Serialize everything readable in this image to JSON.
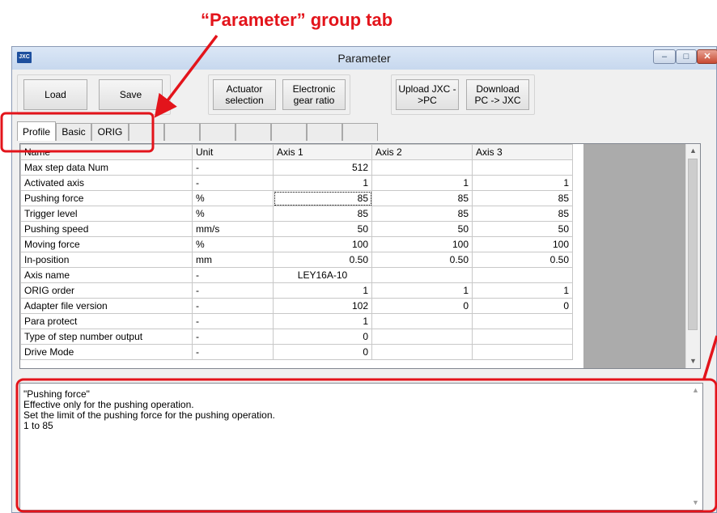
{
  "annotation": {
    "tab_callout": "“Parameter” group tab"
  },
  "window": {
    "app_icon": "JXC",
    "title": "Parameter",
    "minimize_glyph": "–",
    "maximize_glyph": "□",
    "close_glyph": "✕"
  },
  "toolbar": {
    "load": "Load",
    "save": "Save",
    "actuator": "Actuator selection",
    "gear": "Electronic gear ratio",
    "upload": "Upload JXC ->PC",
    "download": "Download PC -> JXC"
  },
  "tabs": [
    "Profile",
    "Basic",
    "ORIG"
  ],
  "grid": {
    "headers": [
      "Name",
      "Unit",
      "Axis 1",
      "Axis 2",
      "Axis 3"
    ],
    "rows": [
      [
        "Max step data Num",
        "-",
        "512",
        "",
        ""
      ],
      [
        "Activated axis",
        "-",
        "1",
        "1",
        "1"
      ],
      [
        "Pushing force",
        "%",
        "85",
        "85",
        "85"
      ],
      [
        "Trigger level",
        "%",
        "85",
        "85",
        "85"
      ],
      [
        "Pushing speed",
        "mm/s",
        "50",
        "50",
        "50"
      ],
      [
        "Moving force",
        "%",
        "100",
        "100",
        "100"
      ],
      [
        "In-position",
        "mm",
        "0.50",
        "0.50",
        "0.50"
      ],
      [
        "Axis name",
        "-",
        "LEY16A-10",
        "",
        ""
      ],
      [
        "ORIG order",
        "-",
        "1",
        "1",
        "1"
      ],
      [
        "Adapter file version",
        "-",
        "102",
        "0",
        "0"
      ],
      [
        "Para protect",
        "-",
        "1",
        "",
        ""
      ],
      [
        "Type of step number output",
        "-",
        "0",
        "",
        ""
      ],
      [
        "Drive Mode",
        "-",
        "0",
        "",
        ""
      ]
    ],
    "scroll_up": "▲",
    "scroll_down": "▼"
  },
  "description": {
    "lines": [
      "\"Pushing force\"",
      "Effective only for the pushing operation.",
      "Set the limit of the pushing force for the pushing operation.",
      "1 to 85"
    ]
  },
  "colors": {
    "annotation_red": "#e3141b",
    "gray_area": "#ababab"
  }
}
